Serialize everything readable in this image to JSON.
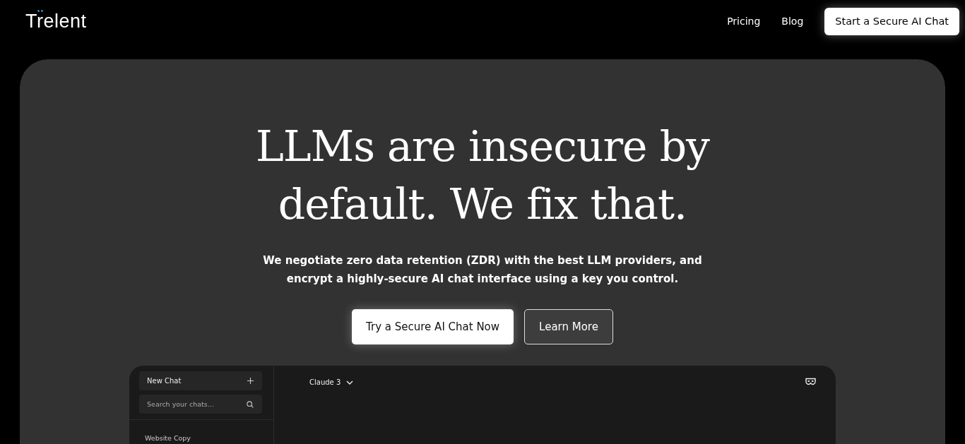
{
  "nav": {
    "logo": "Trelent",
    "links": [
      "Pricing",
      "Blog"
    ],
    "cta": "Start a Secure AI Chat"
  },
  "hero": {
    "title_lines": [
      "LLMs are insecure by",
      "default. We fix that."
    ],
    "subtitle_lines": [
      "We negotiate zero data retention (ZDR) with the best LLM providers, and",
      "encrypt a highly-secure AI chat interface using a key you control."
    ],
    "buttons": [
      {
        "label": "Try a Secure AI Chat Now",
        "kind": "primary"
      },
      {
        "label": "Learn More",
        "kind": "outline"
      }
    ]
  },
  "app": {
    "new_chat": "New Chat",
    "search": {
      "placeholder": "Search your chats..."
    },
    "chats": [
      "Website Copy"
    ],
    "model": "Claude 3"
  }
}
